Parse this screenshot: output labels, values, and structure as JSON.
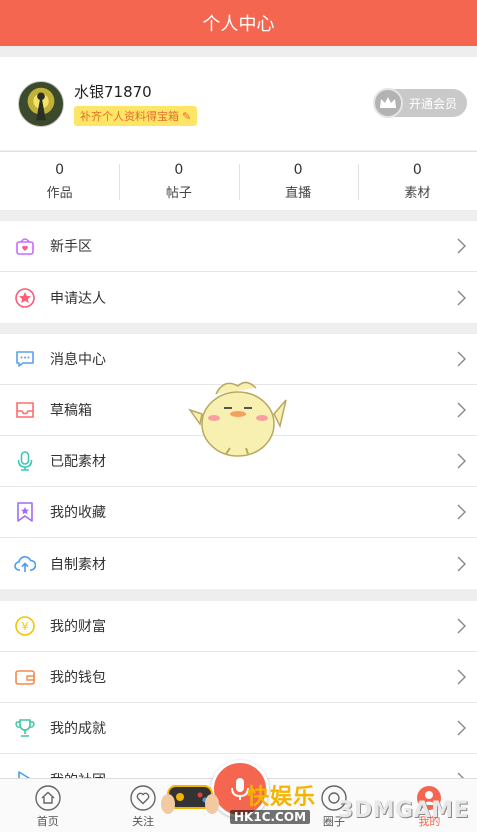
{
  "header": {
    "title": "个人中心"
  },
  "profile": {
    "username": "水银71870",
    "promo": "补齐个人资料得宝箱",
    "vip_label": "开通会员"
  },
  "stats": [
    {
      "value": "0",
      "label": "作品"
    },
    {
      "value": "0",
      "label": "帖子"
    },
    {
      "value": "0",
      "label": "直播"
    },
    {
      "value": "0",
      "label": "素材"
    }
  ],
  "menu_group1": [
    {
      "label": "新手区",
      "icon": "gift-heart-icon",
      "color": "#c76cff"
    },
    {
      "label": "申请达人",
      "icon": "star-badge-icon",
      "color": "#ff5a7a"
    }
  ],
  "menu_group2": [
    {
      "label": "消息中心",
      "icon": "chat-icon",
      "color": "#5aa0f0"
    },
    {
      "label": "草稿箱",
      "icon": "inbox-icon",
      "color": "#ff6b6b"
    },
    {
      "label": "已配素材",
      "icon": "microphone-icon",
      "color": "#3ec7b3"
    },
    {
      "label": "我的收藏",
      "icon": "bookmark-star-icon",
      "color": "#a06cf0"
    },
    {
      "label": "自制素材",
      "icon": "cloud-upload-icon",
      "color": "#4a9cf0"
    }
  ],
  "menu_group3": [
    {
      "label": "我的财富",
      "icon": "coin-icon",
      "color": "#f5c400"
    },
    {
      "label": "我的钱包",
      "icon": "wallet-icon",
      "color": "#f58a4a"
    },
    {
      "label": "我的成就",
      "icon": "trophy-icon",
      "color": "#3ec7a0"
    },
    {
      "label": "我的社团",
      "icon": "play-icon",
      "color": "#4a9cf0"
    }
  ],
  "tabs": [
    {
      "label": "首页",
      "icon": "home-icon"
    },
    {
      "label": "关注",
      "icon": "heart-icon"
    },
    {
      "label": "圈子",
      "icon": "circle-icon"
    },
    {
      "label": "我的",
      "icon": "user-icon"
    }
  ],
  "watermark": {
    "text": "快娱乐",
    "site": "HK1C.COM",
    "brand": "3DMGAME"
  },
  "colors": {
    "accent": "#f4664f"
  }
}
